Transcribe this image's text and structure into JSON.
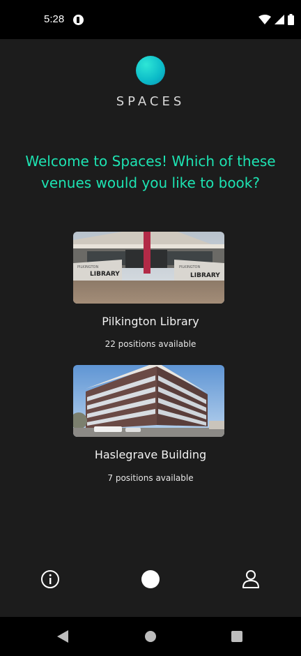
{
  "status_bar": {
    "time": "5:28"
  },
  "header": {
    "brand": "SPACES",
    "logo_colors": [
      "#2ee6d6",
      "#0a8fb2"
    ]
  },
  "welcome": {
    "line1": "Welcome to Spaces! Which of these",
    "line2": "venues would you like to book?"
  },
  "venues": [
    {
      "name": "Pilkington Library",
      "positions": "22 positions available",
      "image_sign_small": "PILKINGTON",
      "image_sign_large": "LIBRARY"
    },
    {
      "name": "Haslegrave Building",
      "positions": "7 positions available"
    }
  ],
  "bottom_nav": {
    "items": [
      "info-icon",
      "home-icon",
      "profile-icon"
    ]
  },
  "system_nav": {
    "items": [
      "back-icon",
      "home-icon",
      "recents-icon"
    ]
  },
  "colors": {
    "accent": "#1de3b2",
    "background": "#1c1c1c"
  }
}
